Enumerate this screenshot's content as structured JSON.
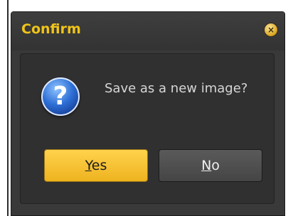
{
  "dialog": {
    "title": "Confirm",
    "close_glyph": "×",
    "message": "Save as a new image?",
    "icon": "question-icon",
    "icon_glyph": "?",
    "buttons": {
      "yes": {
        "mnemonic": "Y",
        "rest": "es"
      },
      "no": {
        "mnemonic": "N",
        "rest": "o"
      }
    }
  },
  "colors": {
    "title_accent": "#f0c419",
    "primary_button": "#ffd24c",
    "secondary_button": "#4f4f4f",
    "dialog_background": "#393939"
  }
}
